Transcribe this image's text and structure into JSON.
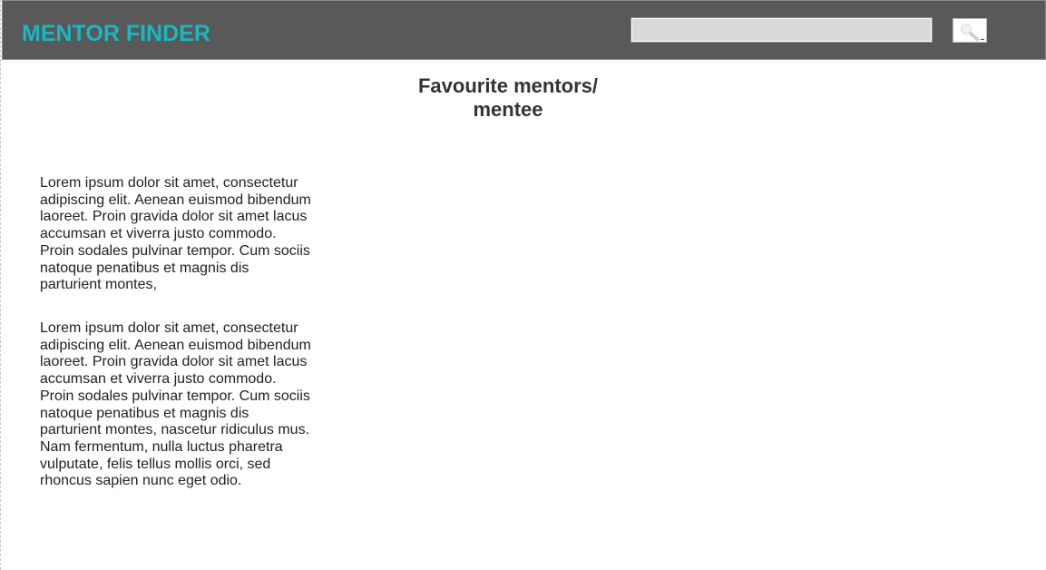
{
  "header": {
    "logo_text": "MENTOR FINDER",
    "search": {
      "value": "",
      "placeholder": ""
    },
    "search_button_icon": "magnifier-icon",
    "colors": {
      "bar": "#595959",
      "logo": "#19b7c0"
    }
  },
  "main": {
    "title_line1": "Favourite mentors/",
    "title_line2": "mentee",
    "paragraphs": [
      "Lorem ipsum dolor sit amet, consectetur adipiscing elit. Aenean euismod bibendum laoreet. Proin gravida dolor sit amet lacus accumsan et viverra justo commodo. Proin sodales pulvinar tempor. Cum sociis natoque penatibus et magnis dis parturient montes,",
      "Lorem ipsum dolor sit amet, consectetur adipiscing elit. Aenean euismod bibendum laoreet. Proin gravida dolor sit amet lacus accumsan et viverra justo commodo. Proin sodales pulvinar tempor. Cum sociis natoque penatibus et magnis dis parturient montes, nascetur ridiculus mus. Nam fermentum, nulla luctus pharetra vulputate, felis tellus mollis orci, sed rhoncus sapien nunc eget odio."
    ]
  }
}
